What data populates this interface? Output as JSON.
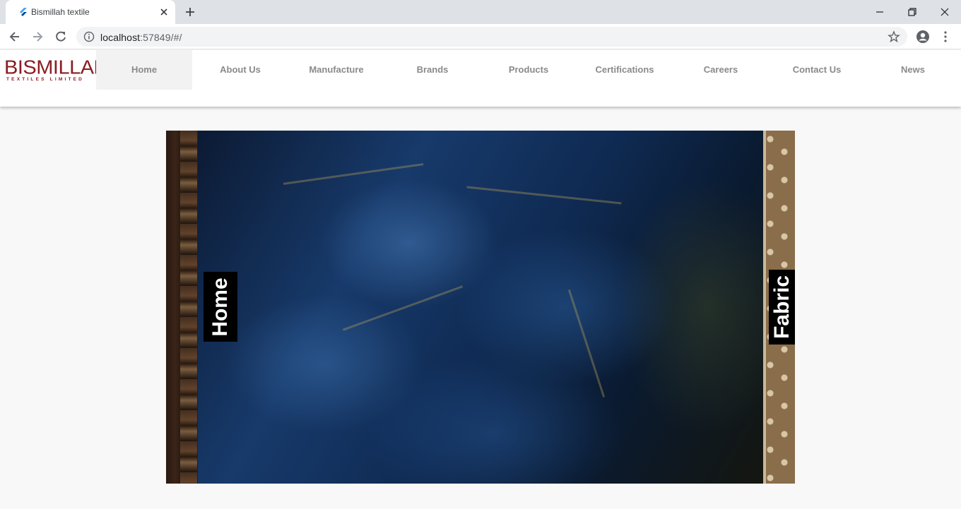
{
  "browser": {
    "tab_title": "Bismillah textile",
    "url_host": "localhost",
    "url_rest": ":57849/#/"
  },
  "site": {
    "logo_text": "BISMILLAH",
    "logo_subtext": "TEXTILES LIMITED",
    "brand_color": "#8b1d22",
    "nav": [
      {
        "label": "Home",
        "active": true
      },
      {
        "label": "About Us"
      },
      {
        "label": "Manufacture"
      },
      {
        "label": "Brands"
      },
      {
        "label": "Products"
      },
      {
        "label": "Certifications"
      },
      {
        "label": "Careers"
      },
      {
        "label": "Contact Us"
      },
      {
        "label": "News"
      }
    ]
  },
  "carousel": {
    "current_label": "Home",
    "next_label": "Fabric"
  }
}
